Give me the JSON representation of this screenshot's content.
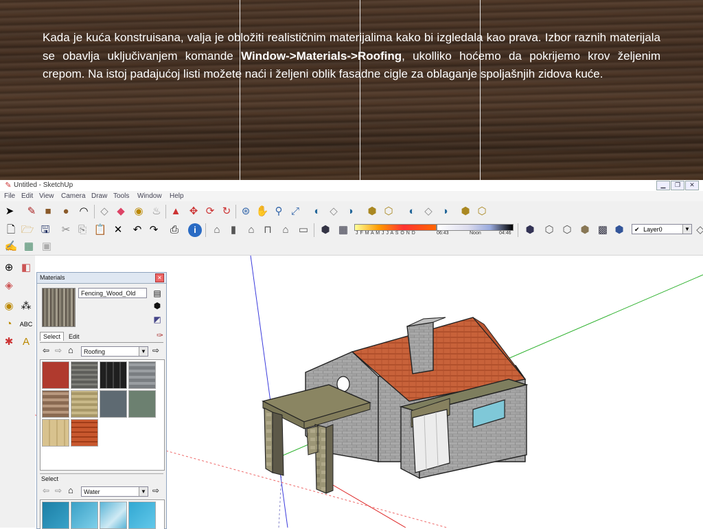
{
  "slide": {
    "text_before": "Kada je kuća konstruisana, valja je obložiti realističnim materijalima kako bi izgledala kao prava. Izbor raznih materijala se obavlja uključivanjem komande ",
    "text_bold": "Window->Materials->Roofing",
    "text_after": ", ukolliko hoćemo da pokrijemo krov željenim crepom. Na istoj padajućoj listi možete naći i željeni oblik fasadne cigle za oblaganje spoljašnjih zidova kuće."
  },
  "app": {
    "window_title": "Untitled - SketchUp",
    "menu": [
      "File",
      "Edit",
      "View",
      "Camera",
      "Draw",
      "Tools",
      "Window",
      "Help"
    ],
    "months": "J F M A M J J A S O N D",
    "time_start": "06:43",
    "time_noon": "Noon",
    "time_end": "04:46",
    "layer": "Layer0"
  },
  "materials": {
    "panel_title": "Materials",
    "current_material": "Fencing_Wood_Old",
    "tab_select": "Select",
    "tab_edit": "Edit",
    "library_1": "Roofing",
    "lower_label": "Select",
    "library_2": "Water",
    "roofing_swatch_colors": [
      "#b03a2e",
      "#6e6e6a",
      "#2a2a2a",
      "#8a8e92",
      "#9a7a62",
      "#b8a878",
      "#5e6a72",
      "#6c8070",
      "#d8c28e",
      "#c8582e"
    ],
    "water_swatch_colors": [
      "#1c7fa6",
      "#3aa0c6",
      "#5ab4d6",
      "#32a8d2"
    ]
  }
}
